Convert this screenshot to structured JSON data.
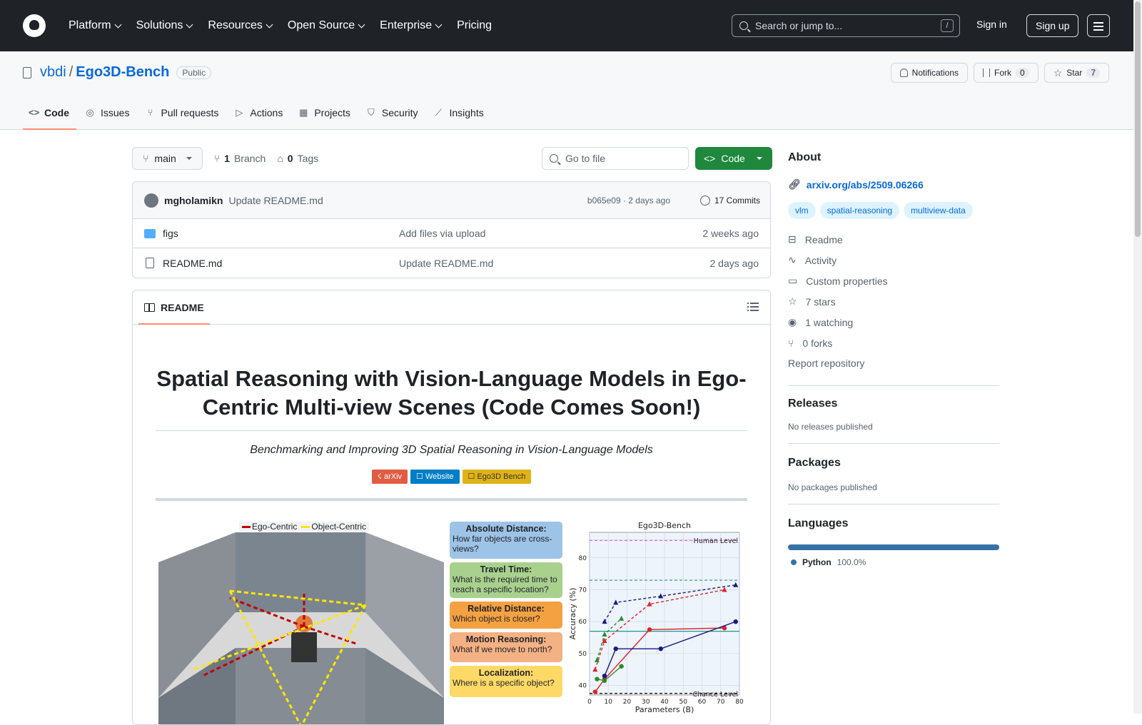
{
  "header": {
    "nav": [
      "Platform",
      "Solutions",
      "Resources",
      "Open Source",
      "Enterprise",
      "Pricing"
    ],
    "search_placeholder": "Search or jump to...",
    "search_key": "/",
    "signin": "Sign in",
    "signup": "Sign up"
  },
  "repo": {
    "owner": "vbdi",
    "name": "Ego3D-Bench",
    "visibility": "Public",
    "notifications": "Notifications",
    "fork_label": "Fork",
    "fork_count": "0",
    "star_label": "Star",
    "star_count": "7",
    "tabs": [
      "Code",
      "Issues",
      "Pull requests",
      "Actions",
      "Projects",
      "Security",
      "Insights"
    ]
  },
  "toolbar": {
    "branch": "main",
    "branches_count": "1",
    "branches_label": "Branch",
    "tags_count": "0",
    "tags_label": "Tags",
    "goto_placeholder": "Go to file",
    "code_label": "Code"
  },
  "commit": {
    "author": "mgholamikn",
    "message": "Update README.md",
    "meta": "b065e09 · 2 days ago",
    "commits": "17 Commits"
  },
  "files": [
    {
      "name": "figs",
      "type": "folder",
      "message": "Add files via upload",
      "date": "2 weeks ago"
    },
    {
      "name": "README.md",
      "type": "file",
      "message": "Update README.md",
      "date": "2 days ago"
    }
  ],
  "readme": {
    "tab": "README",
    "title": "Spatial Reasoning with Vision-Language Models in Ego-Centric Multi-view Scenes (Code Comes Soon!)",
    "subtitle": "Benchmarking and Improving 3D Spatial Reasoning in Vision-Language Models",
    "badges": [
      "☇ arXiv",
      "☐ Website",
      "☐ Ego3D Bench"
    ],
    "figure": {
      "legend_ego": "Ego-Centric",
      "legend_obj": "Object-Centric",
      "tasks": [
        {
          "title": "Absolute Distance:",
          "text": "How far objects are cross-views?"
        },
        {
          "title": "Travel Time:",
          "text": "What is the required time to reach a specific location?"
        },
        {
          "title": "Relative Distance:",
          "text": "Which object is closer?"
        },
        {
          "title": "Motion Reasoning:",
          "text": "What if we move to north?"
        },
        {
          "title": "Localization:",
          "text": "Where is a specific object?"
        }
      ]
    }
  },
  "chart_data": {
    "type": "line",
    "title": "Ego3D-Bench",
    "xlabel": "Parameters (B)",
    "ylabel": "Accuracy (%)",
    "xlim": [
      0,
      80
    ],
    "ylim": [
      37,
      88
    ],
    "xticks": [
      0,
      10,
      20,
      30,
      40,
      50,
      60,
      70,
      80
    ],
    "yticks": [
      40,
      50,
      60,
      70,
      80
    ],
    "reference_lines": [
      {
        "label": "Human Level",
        "y": 85.5,
        "color": "#e040e0"
      },
      {
        "label": "Chance Level",
        "y": 37.5,
        "color": "#000000"
      },
      {
        "label": "",
        "y": 73,
        "color": "#1a9a8a"
      },
      {
        "label": "",
        "y": 57,
        "color": "#1a9a8a"
      }
    ],
    "series": [
      {
        "color": "#e0202a",
        "style": "solid",
        "marker": "circle",
        "x": [
          3,
          8,
          32,
          72
        ],
        "y": [
          38,
          42,
          57.5,
          58
        ]
      },
      {
        "color": "#e0202a",
        "style": "dashed",
        "marker": "triangle",
        "x": [
          3,
          8,
          32,
          72
        ],
        "y": [
          45,
          54,
          65.5,
          70
        ]
      },
      {
        "color": "#1a1a80",
        "style": "solid",
        "marker": "circle",
        "x": [
          8,
          14,
          38,
          78
        ],
        "y": [
          43,
          51.5,
          51.5,
          60
        ]
      },
      {
        "color": "#1a1a80",
        "style": "dashed",
        "marker": "triangle",
        "x": [
          8,
          14,
          38,
          78
        ],
        "y": [
          60,
          66,
          68,
          71.5
        ]
      },
      {
        "color": "#2a8a2a",
        "style": "solid",
        "marker": "circle",
        "x": [
          4,
          8,
          17
        ],
        "y": [
          42,
          41.5,
          46
        ]
      },
      {
        "color": "#2a8a2a",
        "style": "dashed",
        "marker": "triangle",
        "x": [
          4,
          8,
          17
        ],
        "y": [
          48,
          56,
          61
        ]
      }
    ],
    "grid": true
  },
  "sidebar": {
    "about": "About",
    "link": "arxiv.org/abs/2509.06266",
    "topics": [
      "vlm",
      "spatial-reasoning",
      "multiview-data"
    ],
    "items": [
      {
        "icon": "book-icon",
        "label": "Readme"
      },
      {
        "icon": "pulse-icon",
        "label": "Activity"
      },
      {
        "icon": "note-icon",
        "label": "Custom properties"
      },
      {
        "icon": "star-icon",
        "label": "7 stars"
      },
      {
        "icon": "eye-icon",
        "label": "1 watching"
      },
      {
        "icon": "fork-icon",
        "label": "0 forks"
      }
    ],
    "report": "Report repository",
    "releases_title": "Releases",
    "releases_text": "No releases published",
    "packages_title": "Packages",
    "packages_text": "No packages published",
    "languages_title": "Languages",
    "language_name": "Python",
    "language_pct": "100.0%",
    "language_color": "#3572A5"
  }
}
